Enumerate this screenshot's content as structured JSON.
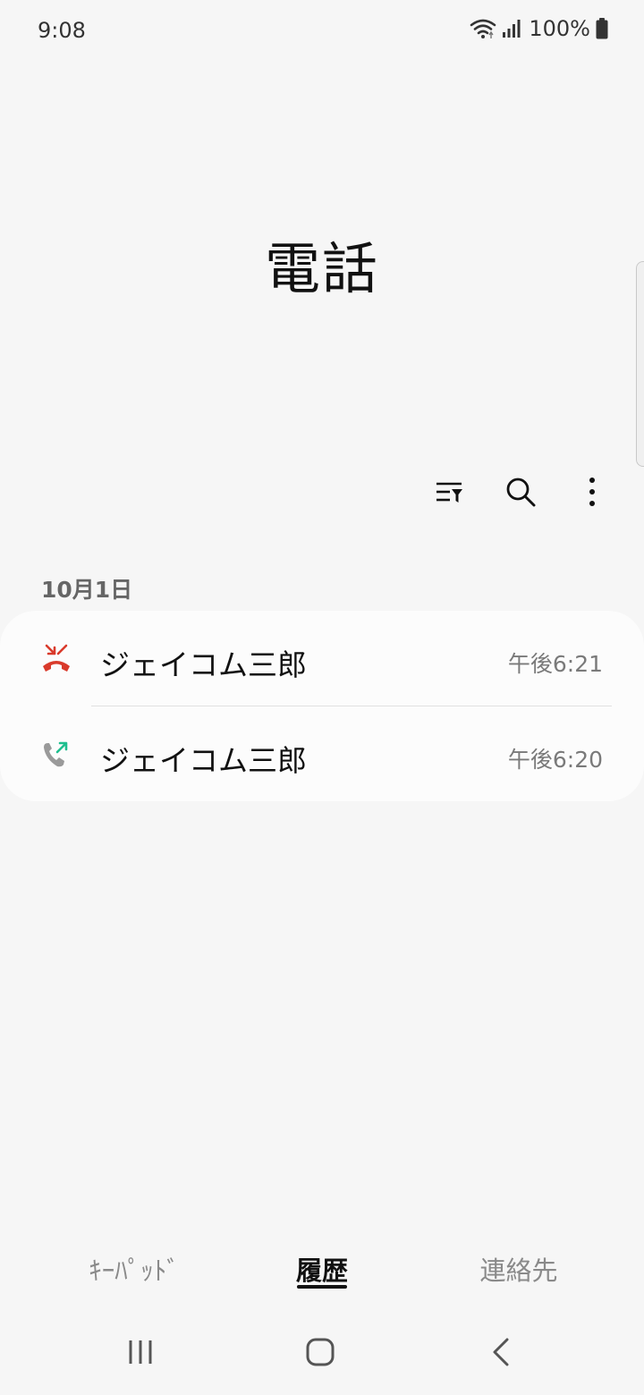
{
  "status_bar": {
    "time": "9:08",
    "battery": "100%",
    "icons": [
      "wifi-icon",
      "signal-icon",
      "battery-icon"
    ]
  },
  "app": {
    "title": "電話"
  },
  "toolbar": {
    "icons": [
      "filter-icon",
      "search-icon",
      "more-options-icon"
    ]
  },
  "call_log": {
    "date_header": "10月1日",
    "calls": [
      {
        "name": "ジェイコム三郎",
        "time": "午後6:21",
        "type": "missed",
        "icon": "missed-call-icon"
      },
      {
        "name": "ジェイコム三郎",
        "time": "午後6:20",
        "type": "outgoing",
        "icon": "outgoing-call-icon"
      }
    ]
  },
  "bottom_tabs": [
    {
      "label": "ｷｰﾊﾟｯﾄﾞ",
      "active": false
    },
    {
      "label": "履歴",
      "active": true
    },
    {
      "label": "連絡先",
      "active": false
    }
  ],
  "nav_bar": {
    "icons": [
      "recent-apps-icon",
      "home-icon",
      "back-icon"
    ]
  },
  "colors": {
    "background": "#f6f6f6",
    "card": "#fcfcfc",
    "missed": "#d93a2b",
    "outgoing_arrow": "#1fbf8f",
    "phone_gray": "#9a9a9a"
  }
}
